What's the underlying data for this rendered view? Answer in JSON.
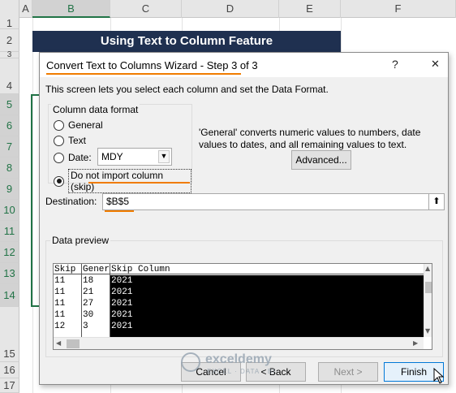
{
  "sheet": {
    "columns": [
      "A",
      "B",
      "C",
      "D",
      "E",
      "F"
    ],
    "rows": [
      "1",
      "2",
      "3",
      "4",
      "5",
      "6",
      "7",
      "8",
      "9",
      "10",
      "11",
      "12",
      "13",
      "14",
      "15",
      "16",
      "17"
    ],
    "title": "Using Text to Column Feature"
  },
  "dialog": {
    "title": "Convert Text to Columns Wizard - Step 3 of 3",
    "help_glyph": "?",
    "close_glyph": "✕",
    "intro": "This screen lets you select each column and set the Data Format.",
    "format_group": {
      "legend": "Column data format",
      "options": [
        "General",
        "Text",
        "Date:",
        "Do not import column (skip)"
      ],
      "selected": "Do not import column (skip)",
      "date_value": "MDY"
    },
    "general_desc": "'General' converts numeric values to numbers, date values to dates, and all remaining values to text.",
    "advanced_label": "Advanced...",
    "destination_label": "Destination:",
    "destination_value": "$B$5",
    "collapse_glyph": "⬆",
    "preview": {
      "legend": "Data preview",
      "headers": [
        "Skip",
        "Gener",
        "Skip Column"
      ],
      "rows": [
        [
          "11",
          "18",
          "2021"
        ],
        [
          "11",
          "21",
          "2021"
        ],
        [
          "11",
          "27",
          "2021"
        ],
        [
          "11",
          "30",
          "2021"
        ],
        [
          "12",
          "3",
          "2021"
        ]
      ]
    },
    "buttons": {
      "cancel": "Cancel",
      "back": "< Back",
      "next": "Next >",
      "finish": "Finish"
    }
  },
  "watermark": {
    "name": "exceldemy",
    "tagline": "EXCEL · DATA · BI"
  },
  "colors": {
    "accent_underline": "#f07c00",
    "selection_green": "#217346",
    "banner_navy": "#1f3050"
  }
}
